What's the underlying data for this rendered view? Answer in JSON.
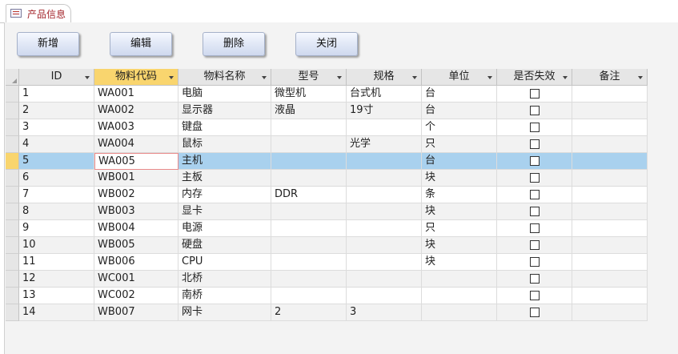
{
  "tab": {
    "title": "产品信息"
  },
  "buttons": {
    "add": "新增",
    "edit": "编辑",
    "delete": "删除",
    "close": "关闭"
  },
  "columns": [
    "ID",
    "物料代码",
    "物料名称",
    "型号",
    "规格",
    "单位",
    "是否失效",
    "备注"
  ],
  "rows": [
    {
      "id": "1",
      "code": "WA001",
      "name": "电脑",
      "model": "微型机",
      "spec": "台式机",
      "unit": "台",
      "inactive": false,
      "note": ""
    },
    {
      "id": "2",
      "code": "WA002",
      "name": "显示器",
      "model": "液晶",
      "spec": "19寸",
      "unit": "台",
      "inactive": false,
      "note": ""
    },
    {
      "id": "3",
      "code": "WA003",
      "name": "键盘",
      "model": "",
      "spec": "",
      "unit": "个",
      "inactive": false,
      "note": ""
    },
    {
      "id": "4",
      "code": "WA004",
      "name": "鼠标",
      "model": "",
      "spec": "光学",
      "unit": "只",
      "inactive": false,
      "note": ""
    },
    {
      "id": "5",
      "code": "WA005",
      "name": "主机",
      "model": "",
      "spec": "",
      "unit": "台",
      "inactive": false,
      "note": ""
    },
    {
      "id": "6",
      "code": "WB001",
      "name": "主板",
      "model": "",
      "spec": "",
      "unit": "块",
      "inactive": false,
      "note": ""
    },
    {
      "id": "7",
      "code": "WB002",
      "name": "内存",
      "model": "DDR",
      "spec": "",
      "unit": "条",
      "inactive": false,
      "note": ""
    },
    {
      "id": "8",
      "code": "WB003",
      "name": "显卡",
      "model": "",
      "spec": "",
      "unit": "块",
      "inactive": false,
      "note": ""
    },
    {
      "id": "9",
      "code": "WB004",
      "name": "电源",
      "model": "",
      "spec": "",
      "unit": "只",
      "inactive": false,
      "note": ""
    },
    {
      "id": "10",
      "code": "WB005",
      "name": "硬盘",
      "model": "",
      "spec": "",
      "unit": "块",
      "inactive": false,
      "note": ""
    },
    {
      "id": "11",
      "code": "WB006",
      "name": "CPU",
      "model": "",
      "spec": "",
      "unit": "块",
      "inactive": false,
      "note": ""
    },
    {
      "id": "12",
      "code": "WC001",
      "name": "北桥",
      "model": "",
      "spec": "",
      "unit": "",
      "inactive": false,
      "note": ""
    },
    {
      "id": "13",
      "code": "WC002",
      "name": "南桥",
      "model": "",
      "spec": "",
      "unit": "",
      "inactive": false,
      "note": ""
    },
    {
      "id": "14",
      "code": "WB007",
      "name": "网卡",
      "model": "2",
      "spec": "3",
      "unit": "",
      "inactive": false,
      "note": ""
    }
  ],
  "selected_row": 5
}
